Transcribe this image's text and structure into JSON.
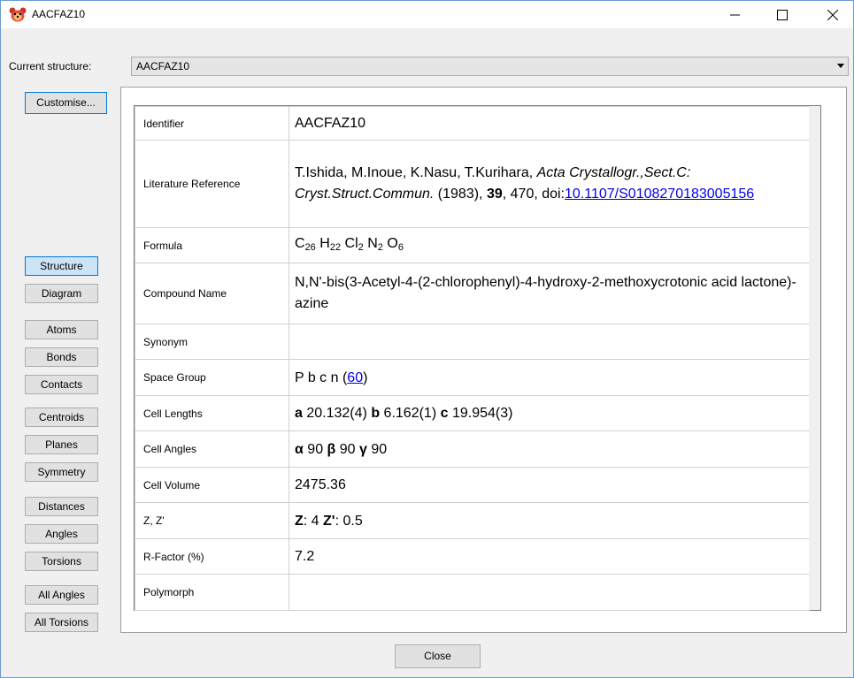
{
  "window": {
    "title": "AACFAZ10",
    "minimize_glyph": "—",
    "maximize_glyph": "☐",
    "close_glyph": "✕"
  },
  "structure_selector": {
    "label": "Current structure:",
    "value": "AACFAZ10"
  },
  "sidebar": {
    "customise_label": "Customise...",
    "groups": [
      [
        "Structure",
        "Diagram"
      ],
      [
        "Atoms",
        "Bonds",
        "Contacts"
      ],
      [
        "Centroids",
        "Planes",
        "Symmetry"
      ],
      [
        "Distances",
        "Angles",
        "Torsions"
      ],
      [
        "All Angles",
        "All Torsions"
      ]
    ],
    "selected": "Structure"
  },
  "info": {
    "identifier": {
      "label": "Identifier",
      "value": "AACFAZ10"
    },
    "literature": {
      "label": "Literature Reference",
      "authors": "T.Ishida, M.Inoue, K.Nasu, T.Kurihara, ",
      "journal": "Acta Crystallogr.,Sect.C: Cryst.Struct.Commun.",
      "year": " (1983), ",
      "volume": "39",
      "pages": ", 470, doi:",
      "doi": "10.1107/S0108270183005156"
    },
    "formula": {
      "label": "Formula",
      "parts": [
        {
          "el": "C",
          "n": "26"
        },
        {
          "el": "H",
          "n": "22"
        },
        {
          "el": "Cl",
          "n": "2"
        },
        {
          "el": "N",
          "n": "2"
        },
        {
          "el": "O",
          "n": "6"
        }
      ]
    },
    "compound_name": {
      "label": "Compound Name",
      "value": "N,N'-bis(3-Acetyl-4-(2-chlorophenyl)-4-hydroxy-2-methoxycrotonic acid lactone)-azine"
    },
    "synonym": {
      "label": "Synonym",
      "value": ""
    },
    "space_group": {
      "label": "Space Group",
      "value": "P b c n",
      "number": "60"
    },
    "cell_lengths": {
      "label": "Cell Lengths",
      "a_label": "a",
      "a": "20.132(4)",
      "b_label": "b",
      "b": "6.162(1)",
      "c_label": "c",
      "c": "19.954(3)"
    },
    "cell_angles": {
      "label": "Cell Angles",
      "alpha_label": "α",
      "alpha": "90",
      "beta_label": "β",
      "beta": "90",
      "gamma_label": "γ",
      "gamma": "90"
    },
    "cell_volume": {
      "label": "Cell Volume",
      "value": "2475.36"
    },
    "z": {
      "label": "Z, Z'",
      "z_label": "Z",
      "z": ": 4 ",
      "zp_label": "Z'",
      "zp": ": 0.5"
    },
    "r_factor": {
      "label": "R-Factor (%)",
      "value": "7.2"
    },
    "polymorph": {
      "label": "Polymorph",
      "value": ""
    }
  },
  "footer": {
    "close_label": "Close"
  }
}
